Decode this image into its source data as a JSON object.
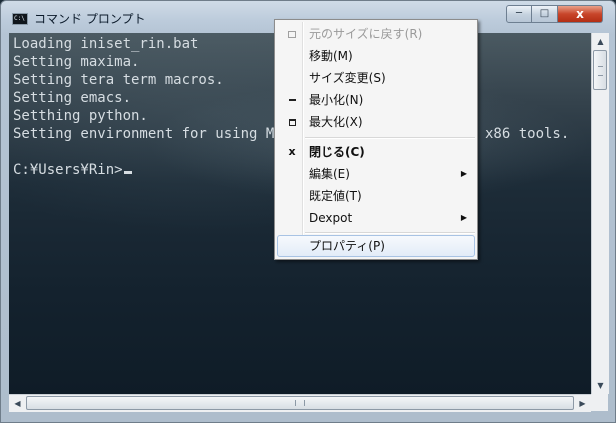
{
  "window": {
    "title": "コマンド プロンプト",
    "title_icon_text": "C:\\",
    "buttons": {
      "minimize": "─",
      "maximize": "□",
      "close": "x"
    }
  },
  "console": {
    "lines": [
      "Loading iniset_rin.bat",
      "Setting maxima.",
      "Setting tera term macros.",
      "Setting emacs.",
      "Setthing python.",
      "Setting environment for using Mic",
      "x86 tools.",
      "",
      "C:¥Users¥Rin>"
    ]
  },
  "scrollbar": {
    "up": "▲",
    "down": "▼",
    "left": "◀",
    "right": "▶"
  },
  "context_menu": {
    "items": [
      {
        "label": "元のサイズに戻す(R)",
        "enabled": false,
        "icon": "restore-icon"
      },
      {
        "label": "移動(M)",
        "enabled": true
      },
      {
        "label": "サイズ変更(S)",
        "enabled": true
      },
      {
        "label": "最小化(N)",
        "enabled": true,
        "icon": "minimize-icon"
      },
      {
        "label": "最大化(X)",
        "enabled": true,
        "icon": "maximize-icon"
      },
      {
        "label": "閉じる(C)",
        "enabled": true,
        "bold": true,
        "icon": "close-icon",
        "icon_glyph": "x"
      },
      {
        "label": "編集(E)",
        "enabled": true,
        "submenu": true
      },
      {
        "label": "既定値(T)",
        "enabled": true
      },
      {
        "label": "Dexpot",
        "enabled": true,
        "submenu": true
      },
      {
        "label": "プロパティ(P)",
        "enabled": true,
        "highlighted": true
      }
    ],
    "submenu_arrow": "▶"
  },
  "colors": {
    "console_text": "#d6dde2",
    "menu_highlight_border": "#a8c3e4",
    "close_button": "#c8452a"
  }
}
